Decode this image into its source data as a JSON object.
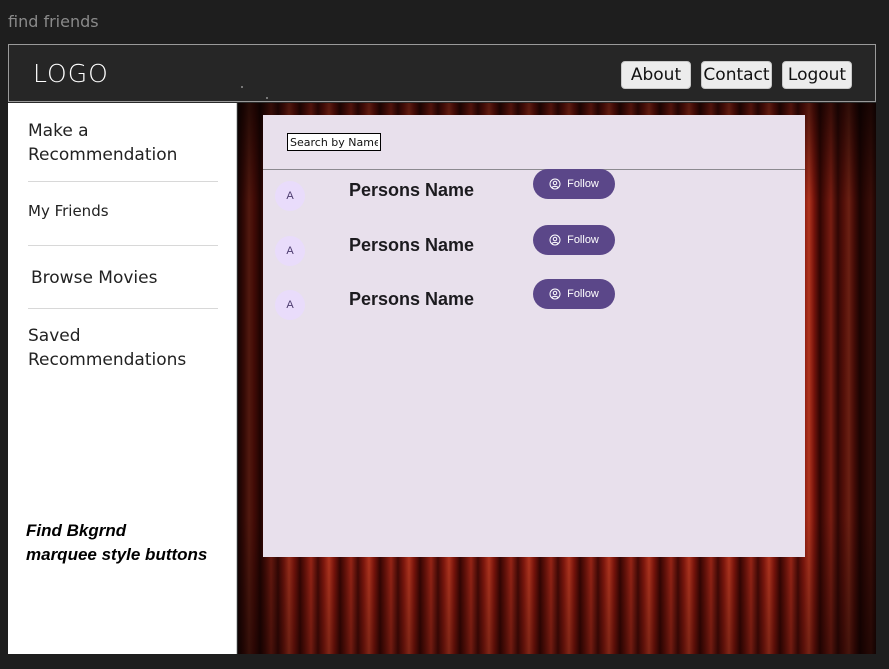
{
  "page": {
    "title": "find friends"
  },
  "navbar": {
    "logo": "LOGO",
    "buttons": [
      {
        "label": "About"
      },
      {
        "label": "Contact"
      },
      {
        "label": "Logout"
      }
    ]
  },
  "sidebar": {
    "items": [
      {
        "label": "Make a Recommendation"
      },
      {
        "label": "My Friends"
      },
      {
        "label": "Browse Movies"
      },
      {
        "label": "Saved Recommendations"
      }
    ],
    "note": "Find Bkgrnd\n marquee style buttons"
  },
  "main": {
    "background": "red-theater-curtain",
    "search": {
      "placeholder": "Search by Name",
      "value": ""
    },
    "people": [
      {
        "avatar_initial": "A",
        "name": "Persons Name",
        "action_label": "Follow",
        "action_icon": "account-circle-icon"
      },
      {
        "avatar_initial": "A",
        "name": "Persons Name",
        "action_label": "Follow",
        "action_icon": "account-circle-icon"
      },
      {
        "avatar_initial": "A",
        "name": "Persons Name",
        "action_label": "Follow",
        "action_icon": "account-circle-icon"
      }
    ]
  },
  "colors": {
    "background": "#1e1e1e",
    "navbar": "#262626",
    "panel": "#e8e0ec",
    "avatar": "#e9dcfb",
    "follow_button": "#5b4789",
    "curtain": "#a82818"
  }
}
